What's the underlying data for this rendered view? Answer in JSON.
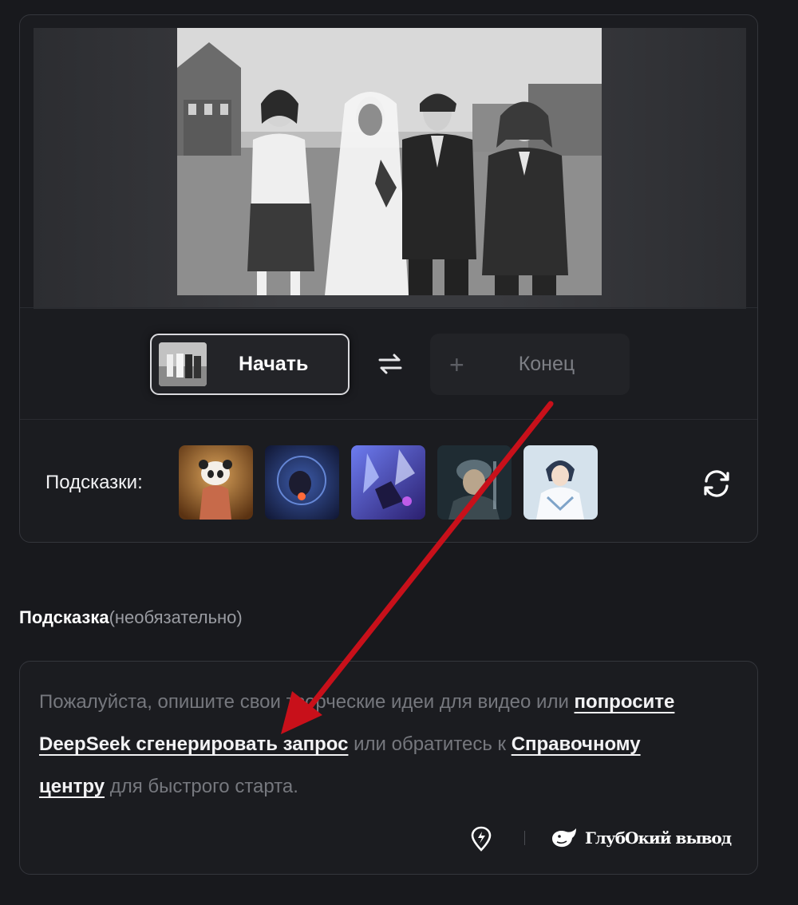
{
  "frames": {
    "start_label": "Начать",
    "end_label": "Конец",
    "swap_icon": "swap-arrows-icon",
    "add_icon": "plus-icon"
  },
  "hints": {
    "label": "Подсказки:",
    "items": [
      "hint-panda",
      "hint-jellyfish",
      "hint-crystal",
      "hint-warrior",
      "hint-anime-character"
    ],
    "refresh_icon": "refresh-icon"
  },
  "prompt": {
    "title": "Подсказка",
    "optional": "(необязательно)",
    "text_part1": "Пожалуйста, опишите свои творческие идеи для видео или ",
    "link1": "попросите DeepSeek сгенерировать запрос",
    "text_part2": " или обратитесь к ",
    "link2": "Справочному центру",
    "text_part3": " для быстрого старта.",
    "deep_output_label": "ГлубОкий вывод",
    "pin_icon": "location-pin-icon",
    "whale_icon": "deepseek-whale-icon"
  },
  "colors": {
    "background": "#18191d",
    "card": "#1b1c20",
    "border": "#34363c",
    "annotation_arrow": "#c8101a"
  }
}
